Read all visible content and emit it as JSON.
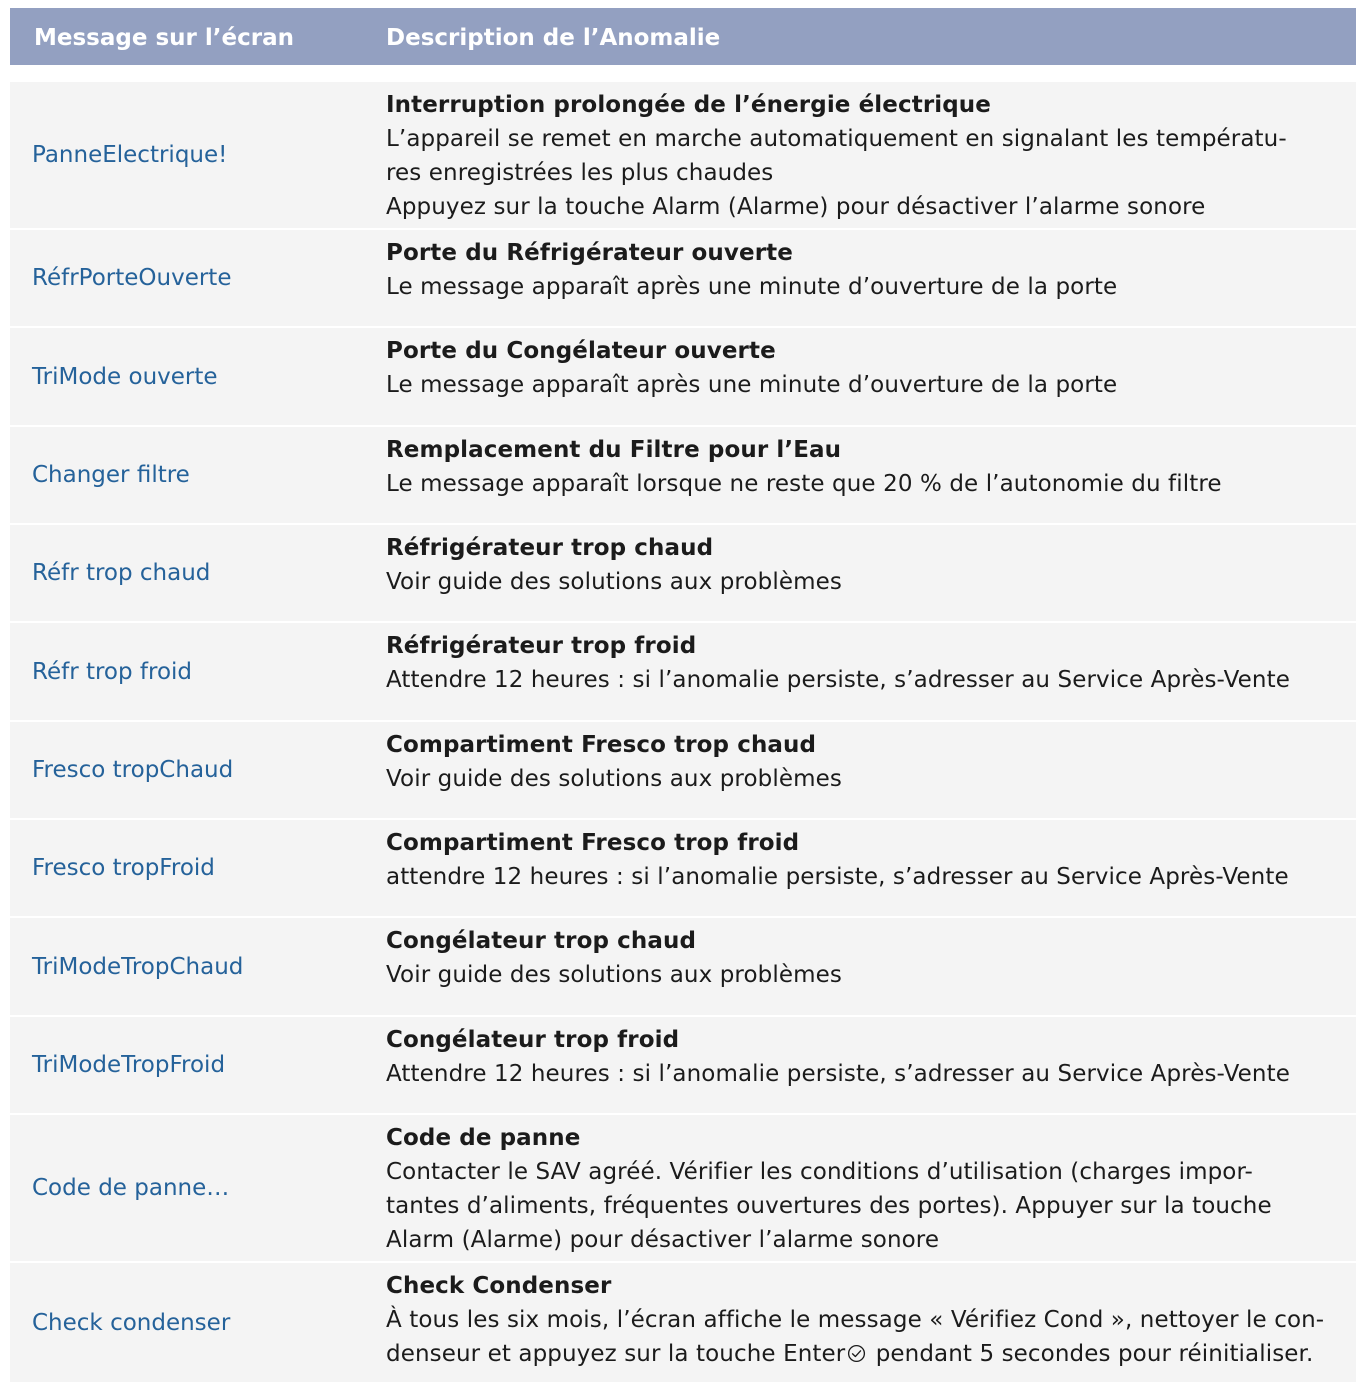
{
  "header": {
    "col_message": "Message sur l’écran",
    "col_description": "Description de l’Anomalie"
  },
  "rows": [
    {
      "message": "PanneElectrique!",
      "title": "Interruption prolongée de l’énergie électrique",
      "lines": [
        "L’appareil se remet en marche automatiquement en signalant les températu-",
        "res enregistrées les plus chaudes",
        "Appuyez sur la touche Alarm (Alarme) pour désactiver l’alarme sonore"
      ]
    },
    {
      "message": "RéfrPorteOuverte",
      "title": "Porte du Réfrigérateur ouverte",
      "lines": [
        "Le message apparaît après une minute d’ouverture de la porte"
      ]
    },
    {
      "message": "TriMode ouverte",
      "title": "Porte du Congélateur ouverte",
      "lines": [
        "Le message apparaît après une minute d’ouverture de la porte"
      ]
    },
    {
      "message": "Changer filtre",
      "title": "Remplacement du Filtre pour l’Eau",
      "lines": [
        "Le message apparaît lorsque ne reste que 20 % de l’autonomie du filtre"
      ]
    },
    {
      "message": "Réfr trop chaud",
      "title": "Réfrigérateur trop chaud",
      "lines": [
        "Voir guide des solutions aux problèmes"
      ]
    },
    {
      "message": "Réfr trop froid",
      "title": "Réfrigérateur trop froid",
      "lines": [
        "Attendre 12 heures : si l’anomalie persiste, s’adresser au Service Après-Vente"
      ]
    },
    {
      "message": "Fresco tropChaud",
      "title": "Compartiment Fresco trop chaud",
      "lines": [
        "Voir guide des solutions aux problèmes"
      ]
    },
    {
      "message": "Fresco tropFroid",
      "title": "Compartiment Fresco trop froid",
      "lines": [
        "attendre 12 heures : si l’anomalie persiste, s’adresser au Service Après-Vente"
      ]
    },
    {
      "message": "TriModeTropChaud",
      "title": "Congélateur trop chaud",
      "lines": [
        "Voir guide des solutions aux problèmes"
      ]
    },
    {
      "message": "TriModeTropFroid",
      "title": "Congélateur trop froid",
      "lines": [
        "Attendre 12 heures : si l’anomalie persiste, s’adresser au Service Après-Vente"
      ]
    },
    {
      "message": "Code de panne…",
      "title": "Code de panne",
      "lines": [
        "Contacter le SAV agréé. Vérifier les conditions d’utilisation (charges impor-",
        "tantes d’aliments, fréquentes ouvertures des portes). Appuyer sur  la touche",
        "Alarm (Alarme) pour désactiver l’alarme sonore"
      ]
    },
    {
      "message": "Check condenser",
      "title": "Check Condenser",
      "lines": [
        "À tous les six mois, l’écran affiche le message « Vérifiez Cond », nettoyer le con-"
      ],
      "last_line_before_icon": "denseur et appuyez sur la touche Enter",
      "last_line_after_icon": " pendant 5 secondes pour réinitialiser.",
      "icon": "enter-check-circle-icon"
    }
  ]
}
